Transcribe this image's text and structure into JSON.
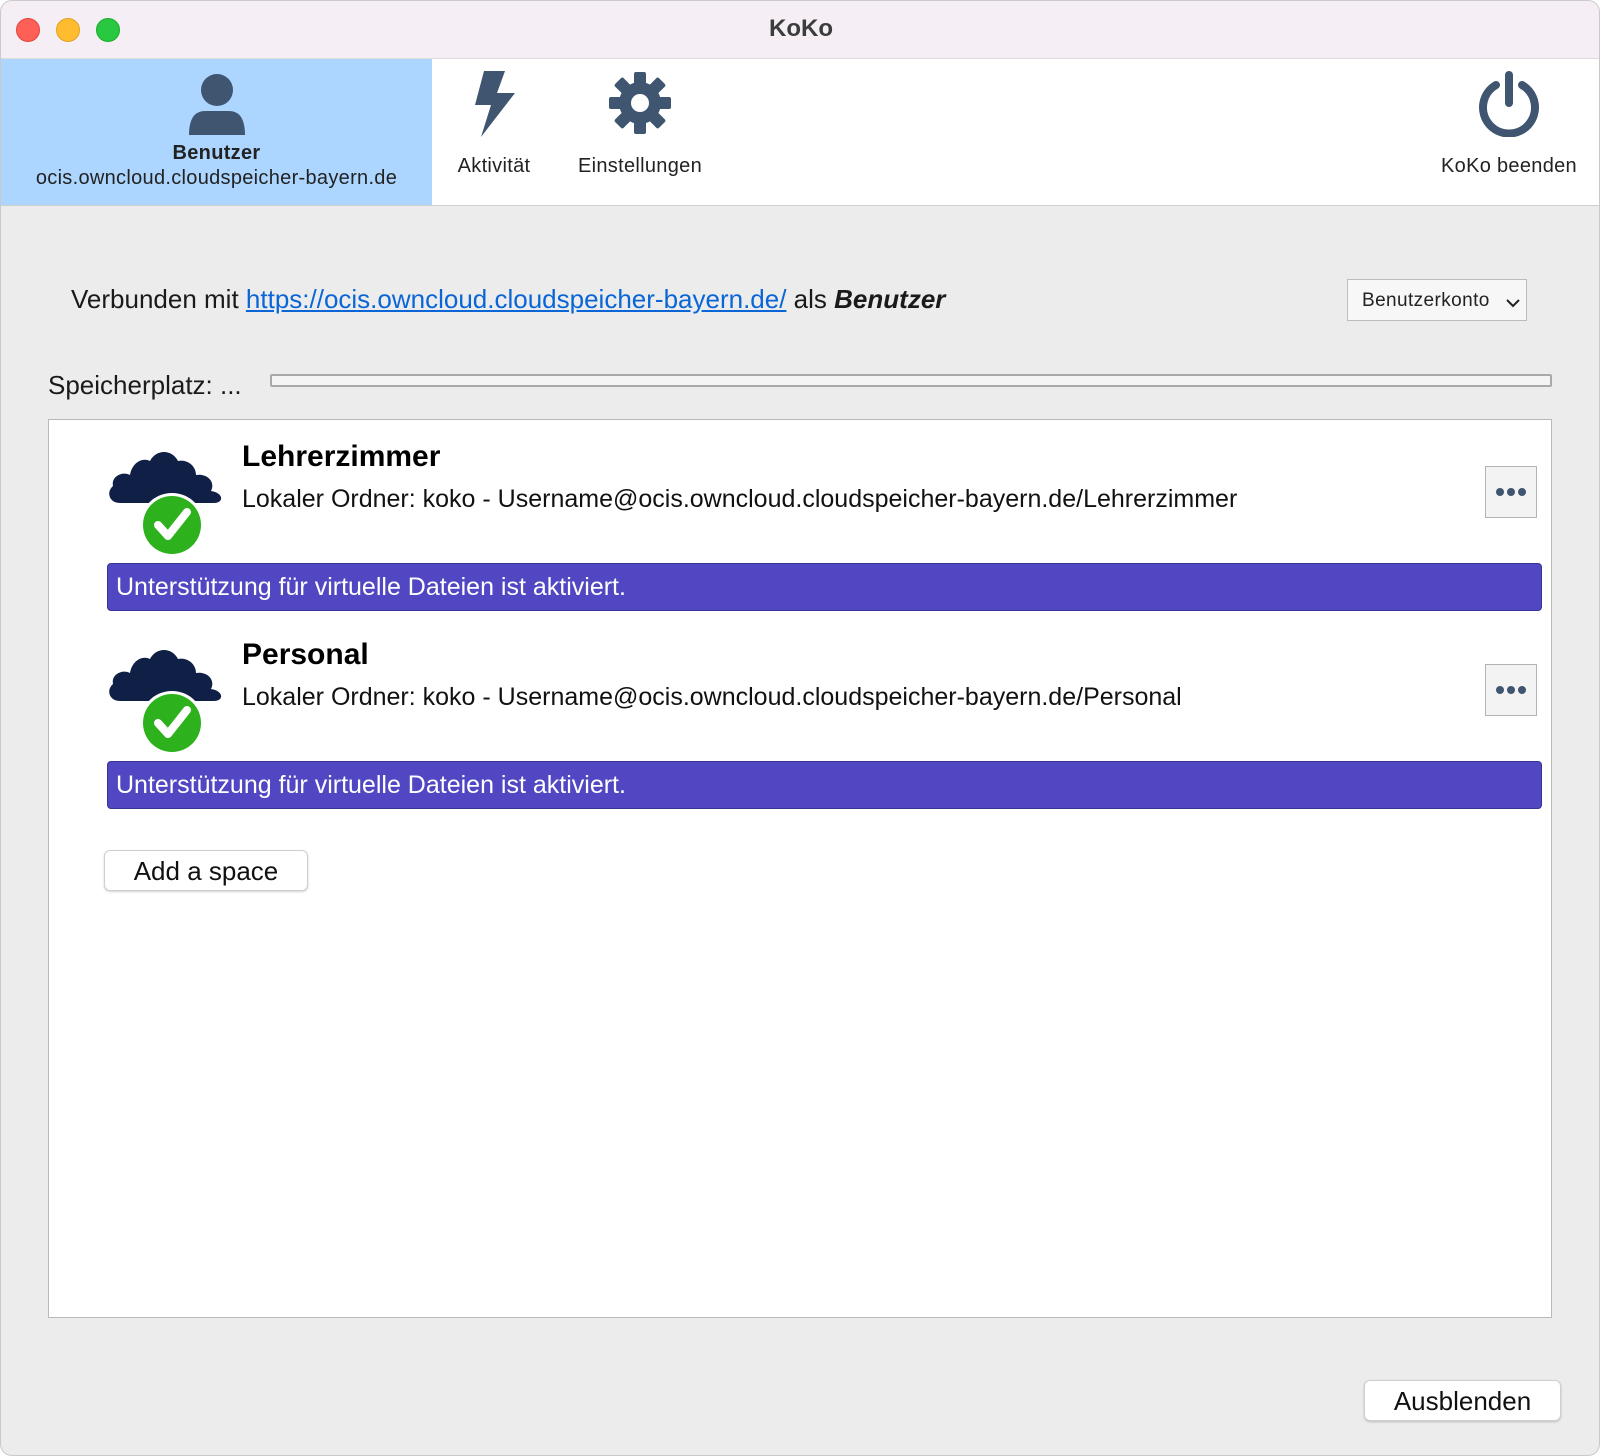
{
  "window": {
    "title": "KoKo"
  },
  "toolbar": {
    "account": {
      "name": "Benutzer",
      "host": "ocis.owncloud.cloudspeicher-bayern.de",
      "icon": "user-icon"
    },
    "activity": {
      "label": "Aktivität",
      "icon": "lightning-icon"
    },
    "settings": {
      "label": "Einstellungen",
      "icon": "gear-icon"
    },
    "quit": {
      "label": "KoKo beenden",
      "icon": "power-icon"
    }
  },
  "connection": {
    "prefix": "Verbunden mit",
    "url": "https://ocis.owncloud.cloudspeicher-bayern.de/",
    "middle": "als",
    "user": "Benutzer",
    "account_menu_label": "Benutzerkonto"
  },
  "storage": {
    "label": "Speicherplatz: ...",
    "used_fraction": 0
  },
  "spaces": [
    {
      "name": "Lehrerzimmer",
      "local_folder": "Lokaler Ordner: koko - Username@ocis.owncloud.cloudspeicher-bayern.de/Lehrerzimmer",
      "banner": "Unterstützung für virtuelle Dateien ist aktiviert.",
      "status_icon": "cloud-check-icon"
    },
    {
      "name": "Personal",
      "local_folder": "Lokaler Ordner: koko - Username@ocis.owncloud.cloudspeicher-bayern.de/Personal",
      "banner": "Unterstützung für virtuelle Dateien ist aktiviert.",
      "status_icon": "cloud-check-icon"
    }
  ],
  "actions": {
    "add_space": "Add a space",
    "hide": "Ausblenden"
  },
  "colors": {
    "active_tab": "#acd6ff",
    "icon_slate": "#3f5570",
    "banner": "#5147c2",
    "cloud": "#0f1f45",
    "check": "#2db21d",
    "link": "#0a66d6"
  }
}
